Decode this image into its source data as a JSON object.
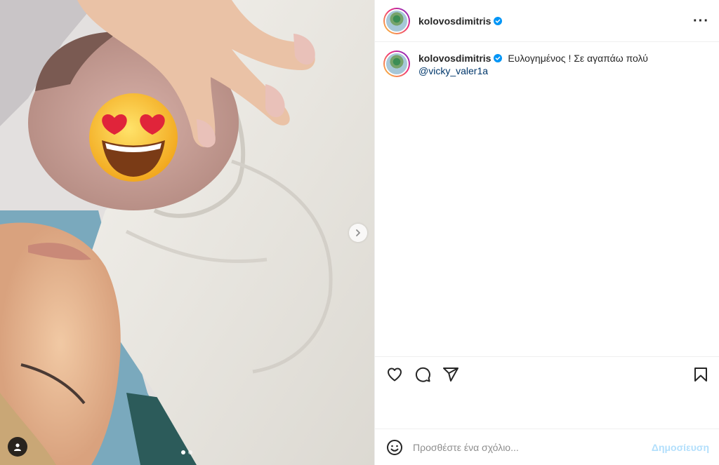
{
  "header": {
    "username": "kolovosdimitris",
    "verified": true,
    "more_icon": "more-horizontal-icon"
  },
  "caption": {
    "username": "kolovosdimitris",
    "text": "Ευλογημένος ! Σε αγαπάω πολύ",
    "mention": "@vicky_valer1a"
  },
  "media": {
    "carousel_count": 2,
    "carousel_active_index": 0,
    "next_icon": "chevron-right-icon",
    "tag_icon": "user-tag-icon"
  },
  "actions": {
    "like_icon": "heart-icon",
    "comment_icon": "comment-icon",
    "share_icon": "send-icon",
    "save_icon": "bookmark-icon"
  },
  "comment_box": {
    "placeholder": "Προσθέστε ένα σχόλιο...",
    "post_label": "Δημοσίευση",
    "emoji_icon": "emoji-icon"
  },
  "colors": {
    "post_button_disabled": "#b2dffc",
    "verified_badge": "#0095f6",
    "mention_link": "#00376b"
  }
}
